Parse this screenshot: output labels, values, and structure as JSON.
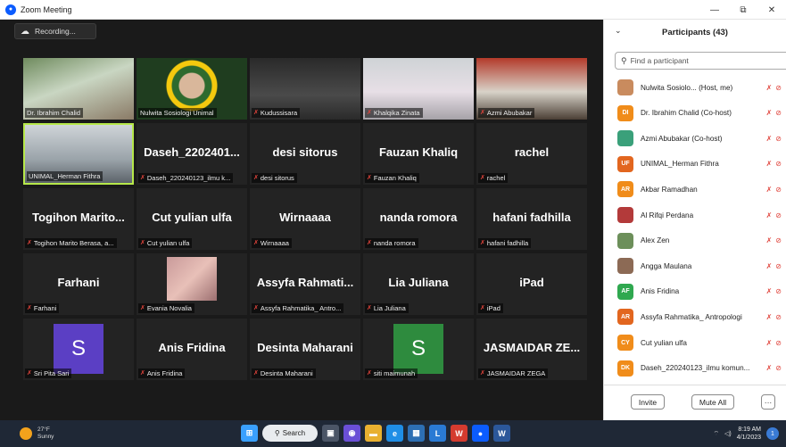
{
  "window": {
    "title": "Zoom Meeting",
    "minimize": "—",
    "maximize": "⧉",
    "close": "✕"
  },
  "recording": {
    "label": "Recording..."
  },
  "tiles": [
    {
      "label": "Dr. Ibrahim Chalid",
      "big": "",
      "muted": false
    },
    {
      "label": "Nulwita Sosiologi Unimal",
      "big": "",
      "muted": false
    },
    {
      "label": "Kudussisara",
      "big": "",
      "muted": true
    },
    {
      "label": "Khalqika Zinata",
      "big": "",
      "muted": true
    },
    {
      "label": "Azmi Abubakar",
      "big": "",
      "muted": true
    },
    {
      "label": "UNIMAL_Herman Fithra",
      "big": "",
      "muted": false
    },
    {
      "label": "Daseh_220240123_ilmu k...",
      "big": "Daseh_2202401...",
      "muted": true
    },
    {
      "label": "desi sitorus",
      "big": "desi sitorus",
      "muted": true
    },
    {
      "label": "Fauzan Khaliq",
      "big": "Fauzan Khaliq",
      "muted": true
    },
    {
      "label": "rachel",
      "big": "rachel",
      "muted": true
    },
    {
      "label": "Togihon Marito Berasa, a...",
      "big": "Togihon Marito...",
      "muted": true
    },
    {
      "label": "Cut yulian ulfa",
      "big": "Cut yulian ulfa",
      "muted": true
    },
    {
      "label": "Wirnaaaa",
      "big": "Wirnaaaa",
      "muted": true
    },
    {
      "label": "nanda romora",
      "big": "nanda romora",
      "muted": true
    },
    {
      "label": "hafani fadhilla",
      "big": "hafani fadhilla",
      "muted": true
    },
    {
      "label": "Farhani",
      "big": "Farhani",
      "muted": true
    },
    {
      "label": "Evania Novalia",
      "big": "",
      "muted": true
    },
    {
      "label": "Assyfa Rahmatika_ Antro...",
      "big": "Assyfa Rahmati...",
      "muted": true
    },
    {
      "label": "Lia Juliana",
      "big": "Lia Juliana",
      "muted": true
    },
    {
      "label": "iPad",
      "big": "iPad",
      "muted": true
    },
    {
      "label": "Sri Pita Sari",
      "big": "",
      "muted": true,
      "avatar": "S",
      "avatar_color": "#5b3fc4"
    },
    {
      "label": "Anis Fridina",
      "big": "Anis Fridina",
      "muted": true
    },
    {
      "label": "Desinta Maharani",
      "big": "Desinta Maharani",
      "muted": true
    },
    {
      "label": "siti maimunah",
      "big": "",
      "muted": true,
      "avatar": "S",
      "avatar_color": "#2e8b3e"
    },
    {
      "label": "JASMAIDAR ZEGA",
      "big": "JASMAIDAR ZE...",
      "muted": true
    }
  ],
  "panel": {
    "title": "Participants (43)",
    "search_placeholder": "Find a participant",
    "participants": [
      {
        "initials": "",
        "name": "Nulwita Sosiolo... (Host, me)",
        "color": "#c98b5e"
      },
      {
        "initials": "DI",
        "name": "Dr. Ibrahim Chalid (Co-host)",
        "color": "#f08c1a"
      },
      {
        "initials": "",
        "name": "Azmi Abubakar (Co-host)",
        "color": "#3aa07a"
      },
      {
        "initials": "UF",
        "name": "UNIMAL_Herman Fithra",
        "color": "#e2661f"
      },
      {
        "initials": "AR",
        "name": "Akbar Ramadhan",
        "color": "#f08c1a"
      },
      {
        "initials": "",
        "name": "Al Rifqi Perdana",
        "color": "#b33a3a"
      },
      {
        "initials": "",
        "name": "Alex Zen",
        "color": "#6c8f5a"
      },
      {
        "initials": "",
        "name": "Angga Maulana",
        "color": "#8c6a55"
      },
      {
        "initials": "AF",
        "name": "Anis Fridina",
        "color": "#2fa84f"
      },
      {
        "initials": "AR",
        "name": "Assyfa Rahmatika_ Antropologi",
        "color": "#e2661f"
      },
      {
        "initials": "CY",
        "name": "Cut yulian ulfa",
        "color": "#f08c1a"
      },
      {
        "initials": "DK",
        "name": "Daseh_220240123_ilmu komun...",
        "color": "#f08c1a"
      }
    ],
    "invite": "Invite",
    "mute_all": "Mute All",
    "more": "···"
  },
  "taskbar": {
    "weather_temp": "27°F",
    "weather_desc": "Sunny",
    "search": "Search",
    "time": "8:19 AM",
    "date": "4/1/2023",
    "notifications": "1"
  }
}
